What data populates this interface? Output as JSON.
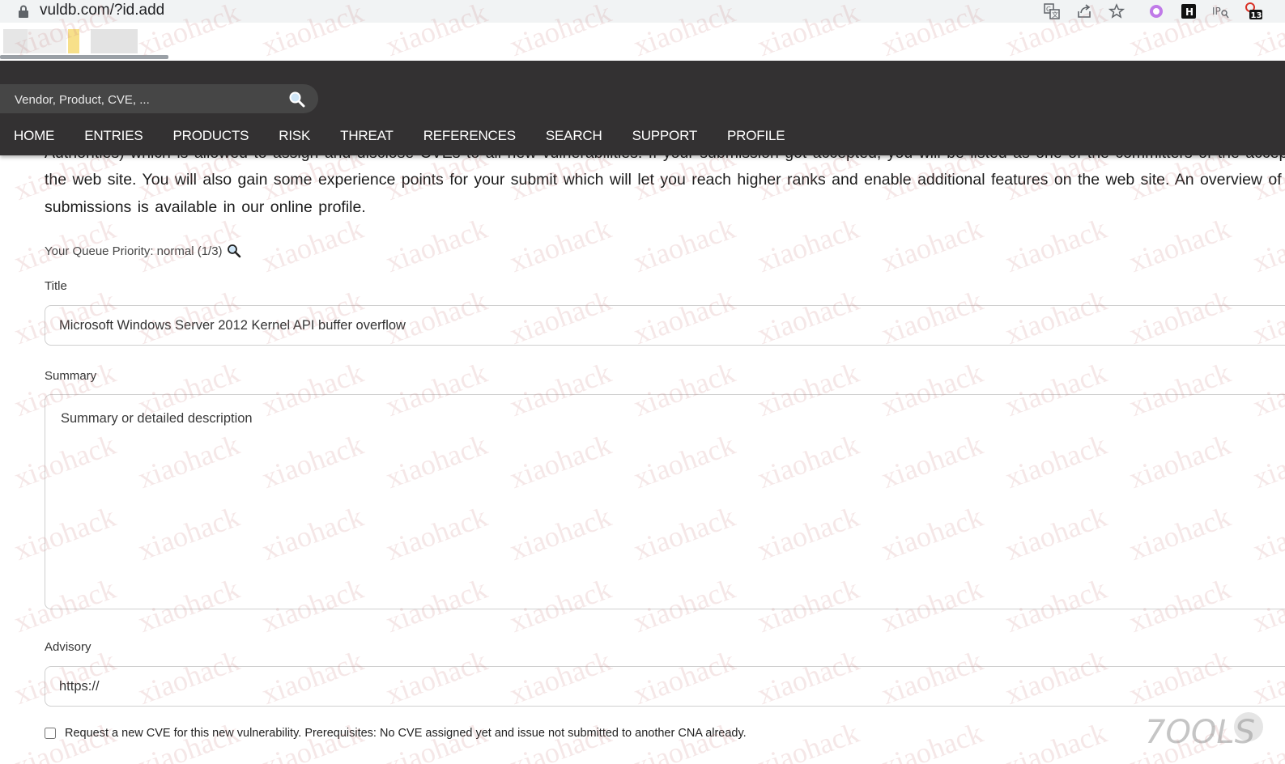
{
  "browser": {
    "url": "vuldb.com/?id.add",
    "extension_badge": "13",
    "icons": [
      "lock-icon",
      "translate-icon",
      "share-icon",
      "star-icon",
      "circle-extension-icon",
      "h-extension-icon",
      "ip-extension-icon",
      "badge-extension-icon"
    ]
  },
  "header": {
    "search_placeholder": "Vendor, Product, CVE, ...",
    "nav": [
      "HOME",
      "ENTRIES",
      "PRODUCTS",
      "RISK",
      "THREAT",
      "REFERENCES",
      "SEARCH",
      "SUPPORT",
      "PROFILE"
    ]
  },
  "intro": {
    "line1": "Authorities) which is allowed to assign and disclose CVEs to all new vulnerabilities. If your submission got accepted, you will be listed as one of the committers of the accepted",
    "line2": "the web site. You will also gain some experience points for your submit which will let you reach higher ranks and enable additional features on the web site. An overview of your",
    "line3": "submissions is available in our online profile."
  },
  "form": {
    "queue_priority": "Your Queue Priority: normal (1/3)",
    "title_label": "Title",
    "title_value": "Microsoft Windows Server 2012 Kernel API buffer overflow",
    "summary_label": "Summary",
    "summary_placeholder": "Summary or detailed description",
    "advisory_label": "Advisory",
    "advisory_value": "https://",
    "cve_request_checked": false,
    "cve_request_label": "Request a new CVE for this new vulnerability. Prerequisites: No CVE assigned yet and issue not submitted to another CNA already."
  },
  "watermark": {
    "text": "xiaohack",
    "logo_text": "7OOLS"
  },
  "colors": {
    "header_bg": "#333132",
    "search_bg": "#464646",
    "nav_text": "#ffffff",
    "watermark": "#c87878"
  }
}
